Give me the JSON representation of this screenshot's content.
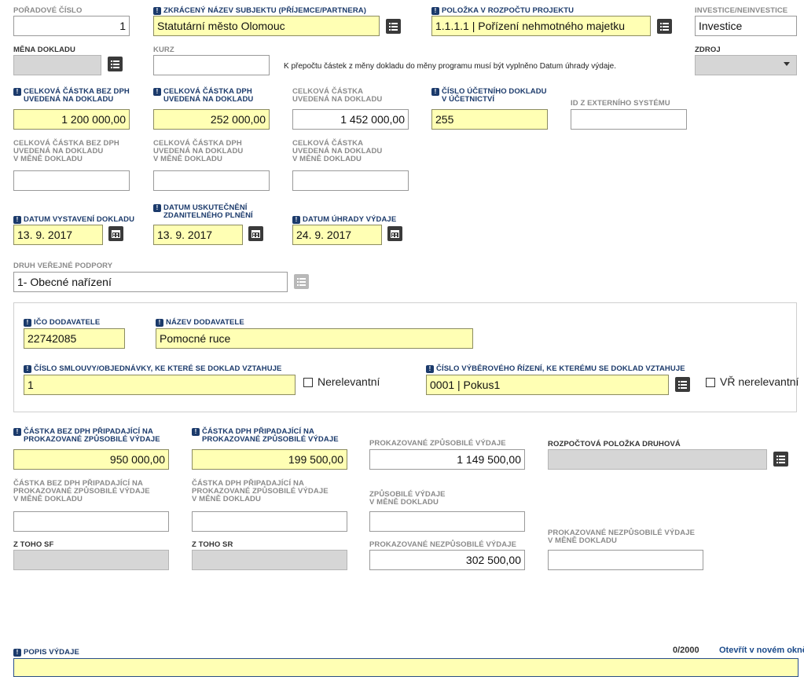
{
  "req_mark": "!",
  "poradove_cislo": {
    "label": "Pořadové číslo",
    "value": "1"
  },
  "nazev_subjektu": {
    "label": "Zkrácený název subjektu (příjemce/partnera)",
    "value": "Statutární město Olomouc"
  },
  "polozka_rozpoctu": {
    "label": "Položka v rozpočtu projektu",
    "value": "1.1.1.1 | Pořízení nehmotného majetku"
  },
  "investice": {
    "label": "Investice/neinvestice",
    "value": "Investice"
  },
  "mena_dokladu": {
    "label": "Měna dokladu",
    "value": ""
  },
  "kurz": {
    "label": "Kurz",
    "value": ""
  },
  "prepocet_note": "K přepočtu částek z měny dokladu do měny programu musí být vyplněno Datum úhrady výdaje.",
  "zdroj": {
    "label": "Zdroj",
    "value": ""
  },
  "castka_bez_dph": {
    "label1": "Celková částka bez DPH",
    "label2": "uvedená na dokladu",
    "value": "1 200 000,00"
  },
  "castka_dph": {
    "label1": "Celková částka DPH",
    "label2": "uvedená na dokladu",
    "value": "252 000,00"
  },
  "castka_celkova": {
    "label1": "Celková částka",
    "label2": "uvedená na dokladu",
    "value": "1 452 000,00"
  },
  "cislo_ucetniho": {
    "label1": "Číslo účetního dokladu",
    "label2": "v účetnictví",
    "value": "255"
  },
  "id_externi": {
    "label": "ID z externího systému",
    "value": ""
  },
  "mena_bez_dph": {
    "label1": "Celková částka bez DPH",
    "label2": "uvedená na dokladu",
    "label3": "v měně dokladu",
    "value": ""
  },
  "mena_dph": {
    "label1": "Celková částka DPH",
    "label2": "uvedená na dokladu",
    "label3": "v měně dokladu",
    "value": ""
  },
  "mena_celkova": {
    "label1": "Celková částka",
    "label2": "uvedená na dokladu",
    "label3": "v měně dokladu",
    "value": ""
  },
  "datum_vystaveni": {
    "label": "Datum vystavení dokladu",
    "value": "13. 9. 2017"
  },
  "datum_uskutecneni": {
    "label1": "Datum uskutečnění",
    "label2": "zdanitelného plnění",
    "value": "13. 9. 2017"
  },
  "datum_uhrady": {
    "label": "Datum úhrady výdaje",
    "value": "24. 9. 2017"
  },
  "druh_podpory": {
    "label": "Druh veřejné podpory",
    "value": "1-  Obecné nařízení"
  },
  "ico_dodavatele": {
    "label": "IČO dodavatele",
    "value": "22742085"
  },
  "nazev_dodavatele": {
    "label": "Název dodavatele",
    "value": "Pomocné ruce"
  },
  "cislo_smlouvy": {
    "label": "Číslo smlouvy/objednávky, ke které se doklad vztahuje",
    "value": "1"
  },
  "nerelevantni": {
    "label": "Nerelevantní"
  },
  "cislo_vr": {
    "label": "Číslo výběrového řízení, ke kterému se doklad vztahuje",
    "value": "0001 | Pokus1"
  },
  "vr_nerelevantni": {
    "label": "VŘ nerelevantní"
  },
  "zpus_bez_dph": {
    "label1": "Částka bez DPH připadající na",
    "label2": "prokazované způsobilé výdaje",
    "value": "950 000,00"
  },
  "zpus_dph": {
    "label1": "Částka DPH připadající na",
    "label2": "prokazované způsobilé výdaje",
    "value": "199 500,00"
  },
  "prok_zpusobile": {
    "label": "Prokazované způsobilé výdaje",
    "value": "1 149 500,00"
  },
  "rozpoctova_polozka": {
    "label": "Rozpočtová položka druhová",
    "value": ""
  },
  "mena_zpus_bez_dph": {
    "label1": "Částka bez DPH připadající na",
    "label2": "prokazované způsobilé výdaje",
    "label3": "v měně dokladu",
    "value": ""
  },
  "mena_zpus_dph": {
    "label1": "Částka DPH připadající na",
    "label2": "prokazované způsobilé výdaje",
    "label3": "v měně dokladu",
    "value": ""
  },
  "mena_zpusobile": {
    "label1": "Způsobilé výdaje",
    "label2": "v měně dokladu",
    "value": ""
  },
  "z_toho_sf": {
    "label": "Z toho SF",
    "value": ""
  },
  "z_toho_sr": {
    "label": "Z toho SR",
    "value": ""
  },
  "prok_nezpusobile": {
    "label": "Prokazované nezpůsobilé výdaje",
    "value": "302 500,00"
  },
  "mena_nezpusobile": {
    "label1": "Prokazované nezpůsobilé výdaje",
    "label2": "v měně dokladu",
    "value": ""
  },
  "popis_vydaje": {
    "label": "Popis výdaje",
    "counter": "0/2000",
    "open_link": "Otevřít v novém okně",
    "value": ""
  }
}
